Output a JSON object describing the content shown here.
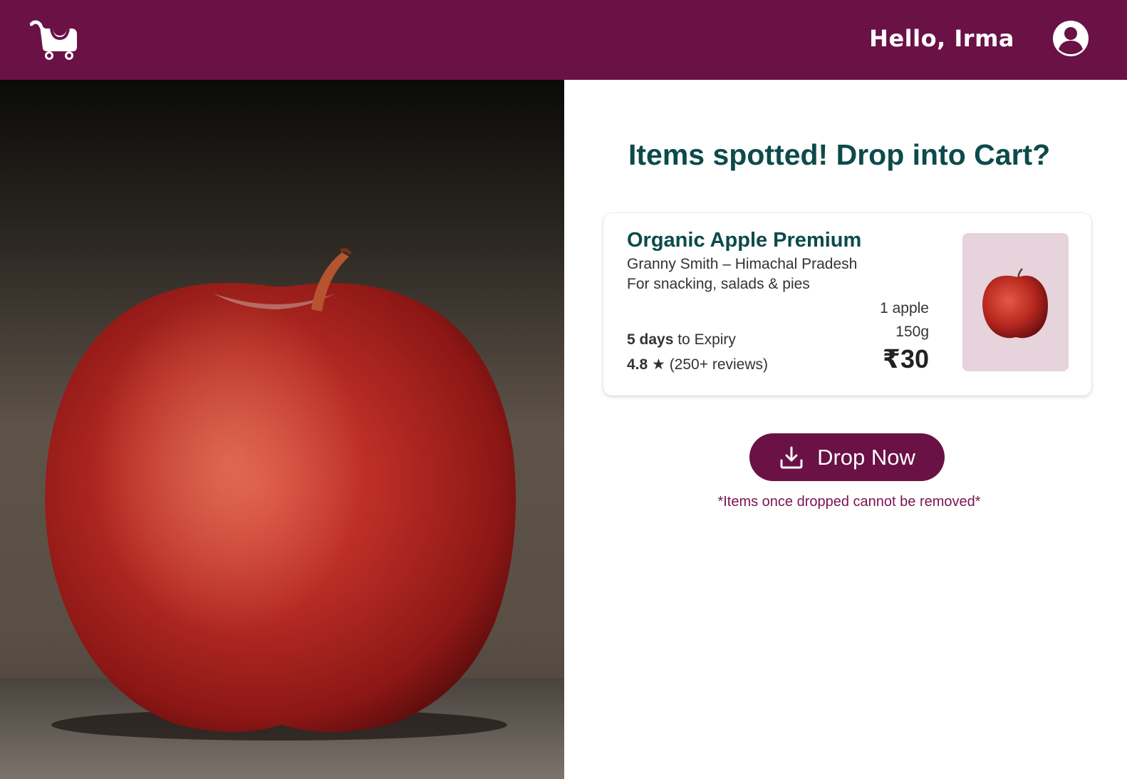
{
  "header": {
    "greeting": "Hello, Irma",
    "logo_icon": "shopping-cart-logo-icon",
    "profile_icon": "user-avatar-icon"
  },
  "main": {
    "heading": "Items spotted! Drop into Cart?",
    "photo": "apple-photo"
  },
  "product": {
    "name": "Organic Apple Premium",
    "variety": "Granny Smith – Himachal Pradesh",
    "use": "For snacking, salads & pies",
    "expiry_days": "5 days",
    "expiry_suffix": " to Expiry",
    "rating_value": "4.8 ★",
    "rating_reviews": " (250+ reviews)",
    "quantity": "1 apple",
    "weight": "150g",
    "price": "₹30",
    "thumbnail": "apple-thumbnail"
  },
  "action": {
    "button_label": "Drop Now",
    "button_icon": "download-icon",
    "note": "*Items once dropped cannot be removed*"
  },
  "colors": {
    "brand": "#6a1145",
    "heading": "#0c4a4b",
    "thumb_bg": "#e6d3dc"
  }
}
